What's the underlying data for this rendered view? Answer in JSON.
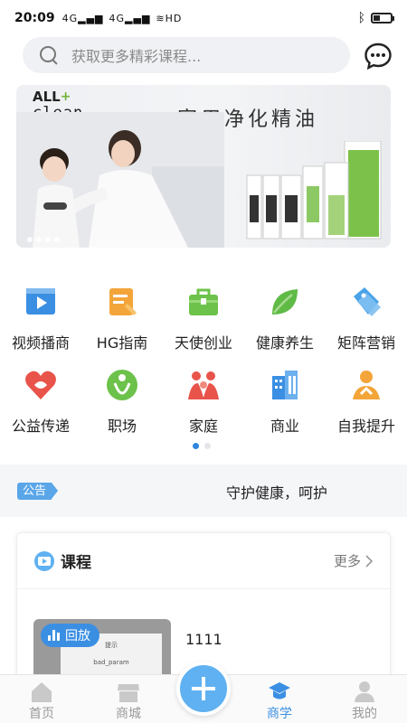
{
  "status_bar": {
    "time": "20:09",
    "signal1": "4G",
    "signal2": "4G",
    "hd": "HD",
    "battery_level": 0.35
  },
  "search": {
    "placeholder": "获取更多精彩课程..."
  },
  "banner": {
    "brand_line1": "ALL",
    "brand_line2": "clean",
    "title": "家用净化精油"
  },
  "categories": [
    {
      "label": "视频播商",
      "icon": "video-icon",
      "color": "#3b8fe3"
    },
    {
      "label": "HG指南",
      "icon": "guide-icon",
      "color": "#f3a53a"
    },
    {
      "label": "天使创业",
      "icon": "briefcase-icon",
      "color": "#6cc24a"
    },
    {
      "label": "健康养生",
      "icon": "leaf-icon",
      "color": "#5fba46"
    },
    {
      "label": "矩阵营销",
      "icon": "tag-icon",
      "color": "#4aa3e8"
    },
    {
      "label": "公益传递",
      "icon": "heart-icon",
      "color": "#e8534a"
    },
    {
      "label": "职场",
      "icon": "person-leaf-icon",
      "color": "#6cc24a"
    },
    {
      "label": "家庭",
      "icon": "family-icon",
      "color": "#e8534a"
    },
    {
      "label": "商业",
      "icon": "building-icon",
      "color": "#3b8fe3"
    },
    {
      "label": "自我提升",
      "icon": "self-improve-icon",
      "color": "#f3a53a"
    }
  ],
  "notice": {
    "badge": "公告",
    "text": "守护健康，呵护"
  },
  "course_section": {
    "title": "课程",
    "more": "更多",
    "items": [
      {
        "badge": "回放",
        "name": "1111",
        "thumb_text1": "提示",
        "thumb_text2": "bad_param"
      }
    ]
  },
  "tabbar": {
    "tabs": [
      {
        "label": "首页",
        "icon": "home-icon"
      },
      {
        "label": "商城",
        "icon": "store-icon"
      },
      {
        "label": "商学",
        "icon": "graduation-cap-icon",
        "active": true
      },
      {
        "label": "我的",
        "icon": "user-icon"
      }
    ],
    "center_icon": "plus-icon"
  },
  "colors": {
    "accent": "#3b8fe3",
    "notice_badge": "#5aa6e8",
    "fab": "#5fb1f1"
  }
}
